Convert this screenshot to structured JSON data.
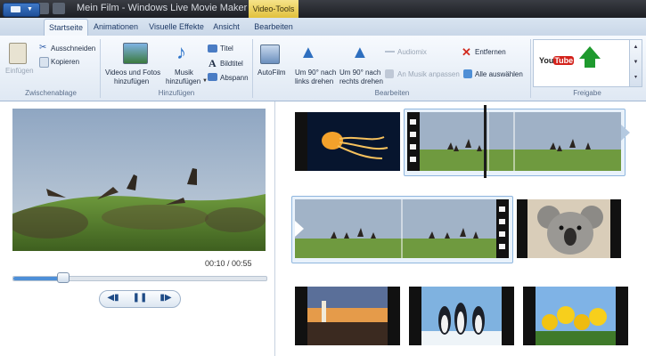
{
  "window": {
    "title": "Mein Film - Windows Live Movie Maker",
    "context_tab": "Video-Tools"
  },
  "tabs": [
    {
      "label": "Startseite",
      "active": true
    },
    {
      "label": "Animationen"
    },
    {
      "label": "Visuelle Effekte"
    },
    {
      "label": "Ansicht"
    },
    {
      "label": "Bearbeiten"
    }
  ],
  "ribbon": {
    "clipboard": {
      "paste": "Einfügen",
      "cut": "Ausschneiden",
      "copy": "Kopieren",
      "group": "Zwischenablage"
    },
    "add": {
      "videos_photos_l1": "Videos und Fotos",
      "videos_photos_l2": "hinzufügen",
      "music_l1": "Musik",
      "music_l2": "hinzufügen",
      "title": "Titel",
      "caption": "Bildtitel",
      "credits": "Abspann",
      "group": "Hinzufügen"
    },
    "edit": {
      "autofilm": "AutoFilm",
      "rotate_left_l1": "Um 90° nach",
      "rotate_left_l2": "links drehen",
      "rotate_right_l1": "Um 90° nach",
      "rotate_right_l2": "rechts drehen",
      "audiomix": "Audiomix",
      "fit_music": "An Musik anpassen",
      "remove": "Entfernen",
      "select_all": "Alle auswählen",
      "group": "Bearbeiten"
    },
    "share": {
      "youtube": "You Tube",
      "group": "Freigabe"
    }
  },
  "player": {
    "timecode": "00:10 / 00:55",
    "progress": 0.18
  },
  "colors": {
    "accent": "#4d8fd8",
    "ribbon_bg": "#dfe8f3",
    "context_tab": "#e2c13c"
  },
  "icons": [
    "paste-icon",
    "cut-icon",
    "copy-icon",
    "add-media-icon",
    "music-icon",
    "title-icon",
    "caption-icon",
    "credits-icon",
    "autofilm-icon",
    "rotate-left-icon",
    "rotate-right-icon",
    "audiomix-icon",
    "fit-music-icon",
    "remove-icon",
    "select-all-icon",
    "youtube-icon",
    "publish-icon",
    "prev-frame-icon",
    "pause-icon",
    "next-frame-icon"
  ]
}
